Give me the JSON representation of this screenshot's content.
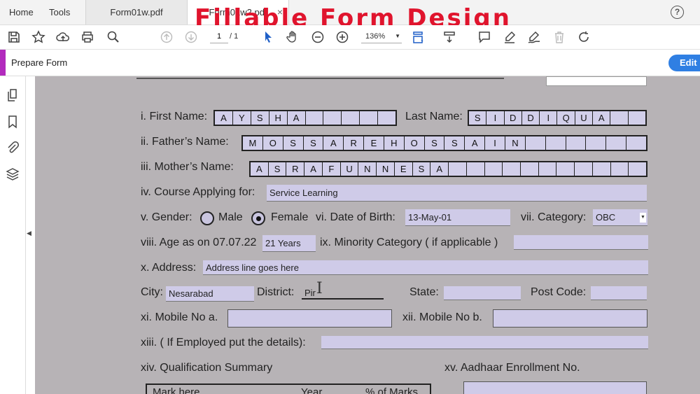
{
  "tabs": {
    "home": "Home",
    "tools": "Tools",
    "doc1": "Form01w.pdf",
    "doc2": "Form01w2.pdf",
    "close": "×"
  },
  "overlay_title": "Fillable Form Design",
  "toolbar": {
    "page_current": "1",
    "page_total": "/ 1",
    "zoom": "136%"
  },
  "prepare_form": {
    "label": "Prepare Form",
    "edit_label": "Edit"
  },
  "form": {
    "first_name_label": "i. First Name:",
    "first_name_chars": [
      "A",
      "Y",
      "S",
      "H",
      "A",
      "",
      "",
      "",
      "",
      ""
    ],
    "last_name_label": "Last Name:",
    "last_name_chars": [
      "S",
      "I",
      "D",
      "D",
      "I",
      "Q",
      "U",
      "A",
      "",
      ""
    ],
    "father_label": "ii. Father’s Name:",
    "father_chars": [
      "M",
      "O",
      "S",
      "S",
      "A",
      "R",
      "E",
      "H",
      "O",
      "S",
      "S",
      "A",
      "I",
      "N",
      "",
      "",
      "",
      "",
      "",
      ""
    ],
    "mother_label": "iii. Mother’s Name:",
    "mother_chars": [
      "A",
      "S",
      "R",
      "A",
      "F",
      "U",
      "N",
      "N",
      "E",
      "S",
      "A",
      "",
      "",
      "",
      "",
      "",
      "",
      "",
      "",
      "",
      "",
      ""
    ],
    "course_label": "iv. Course Applying for:",
    "course_value": "Service Learning",
    "gender_label": "v. Gender:",
    "gender_male": "Male",
    "gender_female": "Female",
    "dob_label": "vi. Date of Birth:",
    "dob_value": "13-May-01",
    "category_label": "vii. Category:",
    "category_value": "OBC",
    "age_label": "viii. Age as on 07.07.22",
    "age_value": "21 Years",
    "minority_label": "ix. Minority Category ( if applicable )",
    "address_label": "x.  Address:",
    "address_value": "Address line goes here",
    "city_label": "City:",
    "city_value": "Nesarabad",
    "district_label": "District:",
    "district_value": "Pir",
    "state_label": "State:",
    "postcode_label": "Post Code:",
    "mobile_a_label": "xi. Mobile No a.",
    "mobile_b_label": "xii. Mobile No b.",
    "employed_label": "xiii. ( If Employed put the details):",
    "qualification_label": "xiv. Qualification Summary",
    "aadhaar_label": "xv. Aadhaar Enrollment No.",
    "table_headers": [
      "Mark here",
      "Year",
      "% of Marks"
    ]
  }
}
